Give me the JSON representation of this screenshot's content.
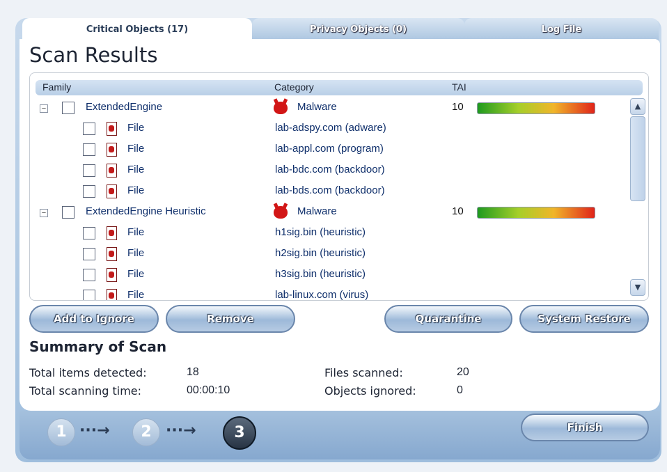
{
  "tabs": [
    {
      "label": "Critical Objects (17)"
    },
    {
      "label": "Privacy Objects (0)"
    },
    {
      "label": "Log File"
    }
  ],
  "title": "Scan Results",
  "grid": {
    "headers": {
      "family": "Family",
      "category": "Category",
      "tai": "TAI"
    },
    "rows": [
      {
        "family": "ExtendedEngine",
        "category": "Malware",
        "tai": "10",
        "group": true
      },
      {
        "family": "File",
        "category": "lab-adspy.com (adware)"
      },
      {
        "family": "File",
        "category": "lab-appl.com (program)"
      },
      {
        "family": "File",
        "category": "lab-bdc.com (backdoor)"
      },
      {
        "family": "File",
        "category": "lab-bds.com (backdoor)"
      },
      {
        "family": "ExtendedEngine Heuristic",
        "category": "Malware",
        "tai": "10",
        "group": true
      },
      {
        "family": "File",
        "category": "h1sig.bin (heuristic)"
      },
      {
        "family": "File",
        "category": "h2sig.bin (heuristic)"
      },
      {
        "family": "File",
        "category": "h3sig.bin (heuristic)"
      },
      {
        "family": "File",
        "category": "lab-linux.com (virus)"
      }
    ]
  },
  "buttons": {
    "add_to_ignore": "Add to Ignore",
    "remove": "Remove",
    "quarantine": "Quarantine",
    "system_restore": "System Restore",
    "finish": "Finish"
  },
  "summary": {
    "title": "Summary of Scan",
    "total_items_label": "Total items detected:",
    "total_items_value": "18",
    "scan_time_label": "Total scanning time:",
    "scan_time_value": "00:00:10",
    "files_scanned_label": "Files scanned:",
    "files_scanned_value": "20",
    "objects_ignored_label": "Objects ignored:",
    "objects_ignored_value": "0"
  },
  "steps": {
    "one": "1",
    "two": "2",
    "three": "3",
    "arrow": "···→"
  },
  "colors": {
    "accent": "#9fbedd",
    "link_text": "#0f2f6b",
    "malware_red": "#d21616"
  }
}
